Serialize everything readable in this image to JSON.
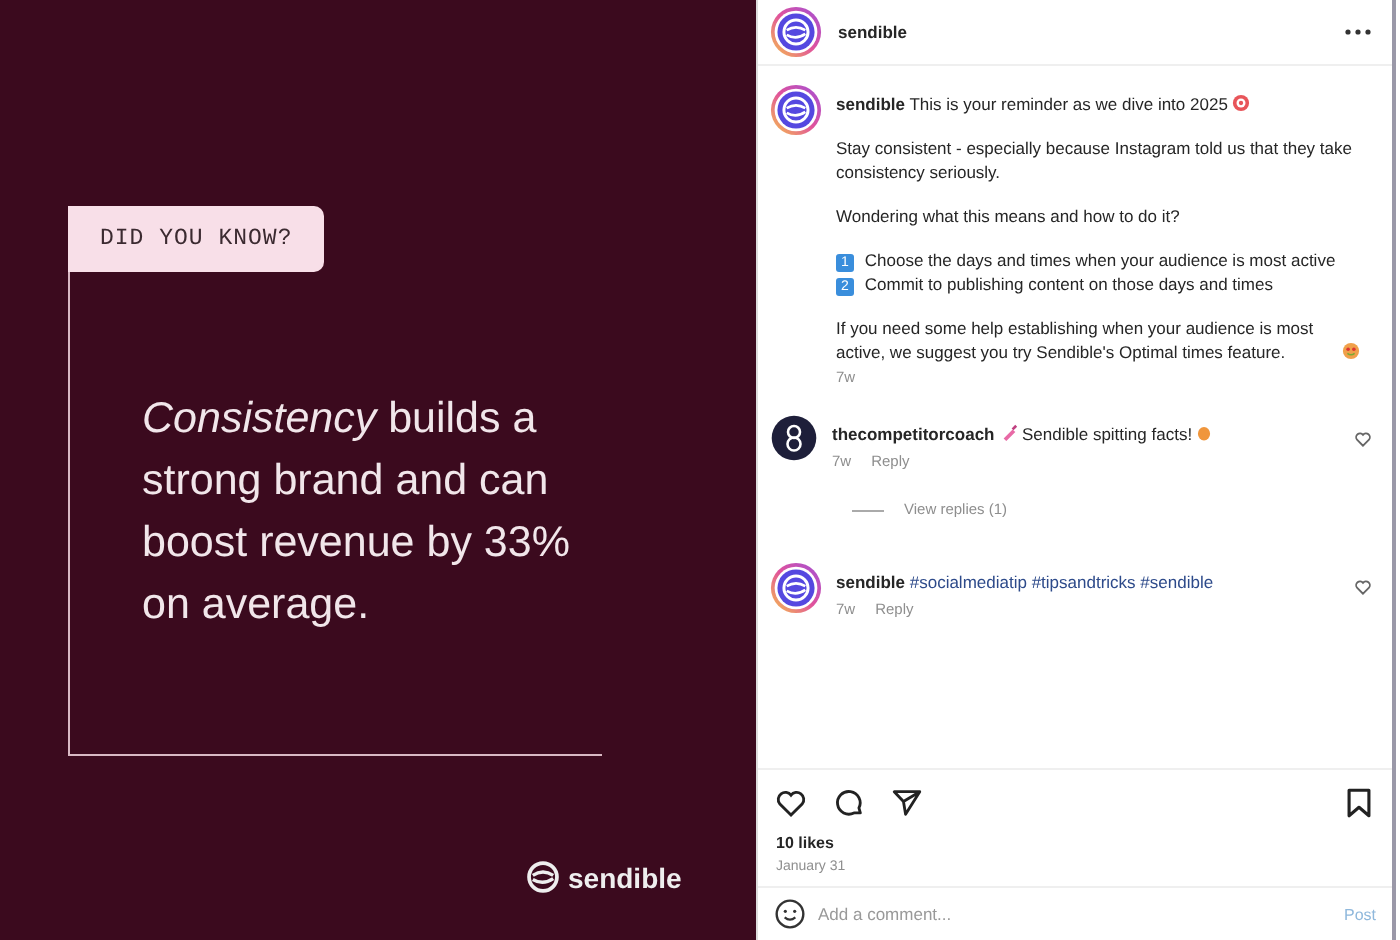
{
  "slide": {
    "badge": "DID YOU KNOW?",
    "headline": "*Consistency* builds a strong brand and can boost revenue by 33% on average.",
    "brand": "sendible"
  },
  "header": {
    "username": "sendible"
  },
  "caption": {
    "username": "sendible",
    "intro": "This is your reminder as we dive into 2025",
    "paragraphs": [
      "Stay consistent - especially because Instagram told us that they take consistency seriously.",
      "Wondering what this means and how to do it?"
    ],
    "steps": [
      {
        "number": "1",
        "text": "Choose the days and times when your audience is most active"
      },
      {
        "number": "2",
        "text": "Commit to publishing content on those days and times"
      }
    ],
    "closing": "If you need some help establishing when your audience is most active, we suggest you try Sendible's Optimal times feature.",
    "age": "7w"
  },
  "comments": [
    {
      "avatar": {
        "kind": "dark"
      },
      "username": "thecompetitorcoach",
      "text": "Sendible spitting facts!",
      "age": "7w",
      "reply": "Reply",
      "view_replies": "View replies (1)"
    },
    {
      "avatar": {
        "kind": "brand"
      },
      "username": "sendible",
      "hashtags": [
        "#socialmediatip",
        "#tipsandtricks",
        "#sendible"
      ],
      "age": "7w",
      "reply": "Reply"
    }
  ],
  "likes": "10 likes",
  "date": "January 31",
  "comment_box": {
    "placeholder": "Add a comment...",
    "post": "Post",
    "post_disabled": true
  }
}
